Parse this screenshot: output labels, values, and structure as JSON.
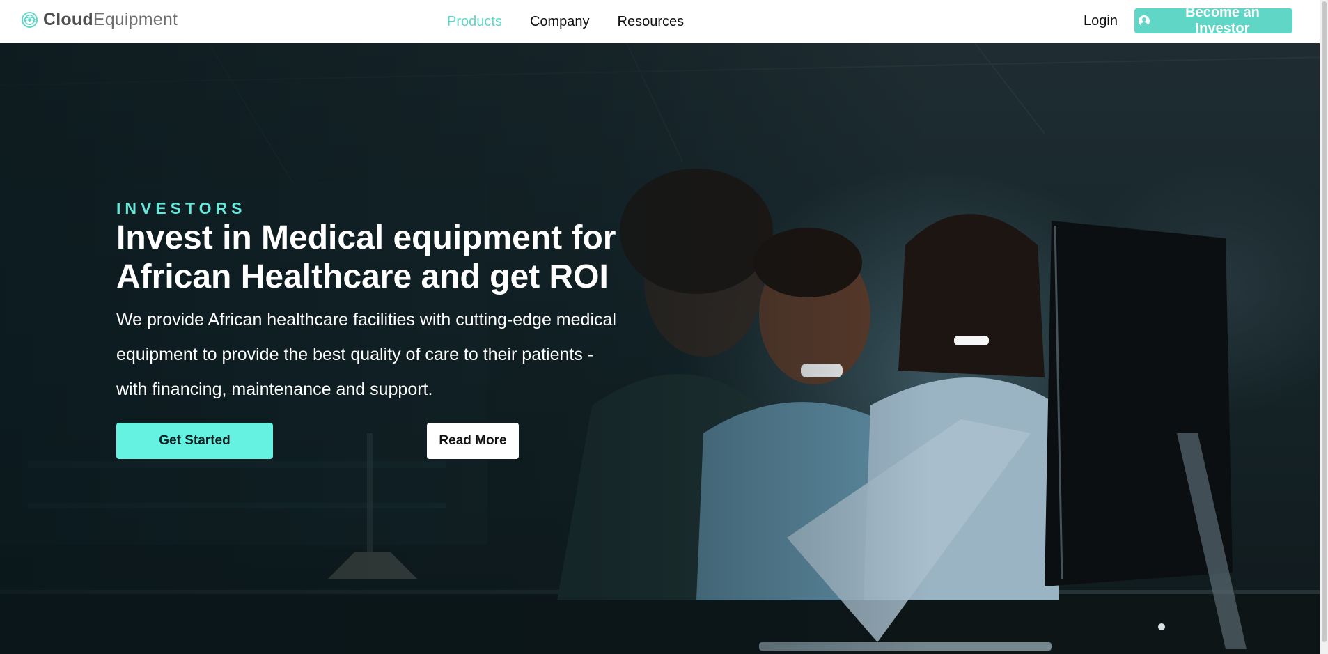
{
  "header": {
    "logo": {
      "bold": "Cloud",
      "regular": "Equipment",
      "icon": "cloud-equipment-logo-icon"
    },
    "nav": [
      {
        "label": "Products",
        "active": true
      },
      {
        "label": "Company",
        "active": false
      },
      {
        "label": "Resources",
        "active": false
      }
    ],
    "login_label": "Login",
    "cta": {
      "label": "Become an Investor",
      "icon": "user-circle-icon"
    }
  },
  "hero": {
    "background": "photo: three people smiling at a computer monitor in a dim office",
    "eyebrow": "INVESTORS",
    "headline_line1": "Invest in Medical equipment for",
    "headline_line2": "African Healthcare and get ROI",
    "subtext_line1": "We provide African healthcare facilities with cutting-edge medical",
    "subtext_line2": "equipment to provide the best quality of care to their patients -",
    "subtext_line3": "with financing, maintenance and support.",
    "primary_button": "Get Started",
    "secondary_button": "Read More"
  },
  "colors": {
    "accent": "#5fd6c6",
    "eyebrow": "#66e8db",
    "primary_button": "#66f2e0",
    "nav_background": "#ffffff"
  }
}
